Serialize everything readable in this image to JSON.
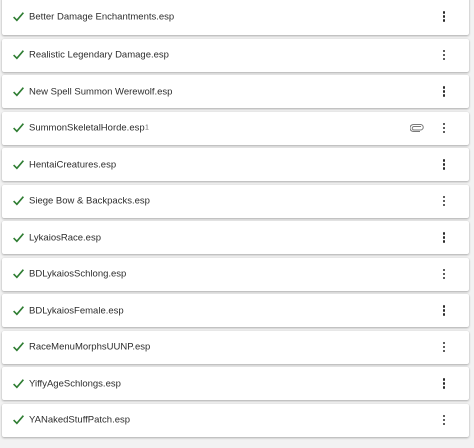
{
  "colors": {
    "check": "#2e7d32",
    "row_bg": "#ffffff",
    "page_bg": "#f2f2f2",
    "text": "#2d2d2d"
  },
  "icons": {
    "status": "check-icon",
    "menu": "more-vert-icon",
    "attachment": "paperclip-icon"
  },
  "plugins": [
    {
      "name": "Better Damage Enchantments.esp"
    },
    {
      "name": "Realistic Legendary Damage.esp"
    },
    {
      "name": "New Spell Summon Werewolf.esp"
    },
    {
      "name": "SummonSkeletalHorde.esp",
      "badge": "1",
      "has_attachment": true
    },
    {
      "name": "HentaiCreatures.esp"
    },
    {
      "name": "Siege Bow & Backpacks.esp"
    },
    {
      "name": "LykaiosRace.esp"
    },
    {
      "name": "BDLykaiosSchlong.esp"
    },
    {
      "name": "BDLykaiosFemale.esp"
    },
    {
      "name": "RaceMenuMorphsUUNP.esp"
    },
    {
      "name": "YiffyAgeSchlongs.esp"
    },
    {
      "name": "YANakedStuffPatch.esp"
    }
  ]
}
